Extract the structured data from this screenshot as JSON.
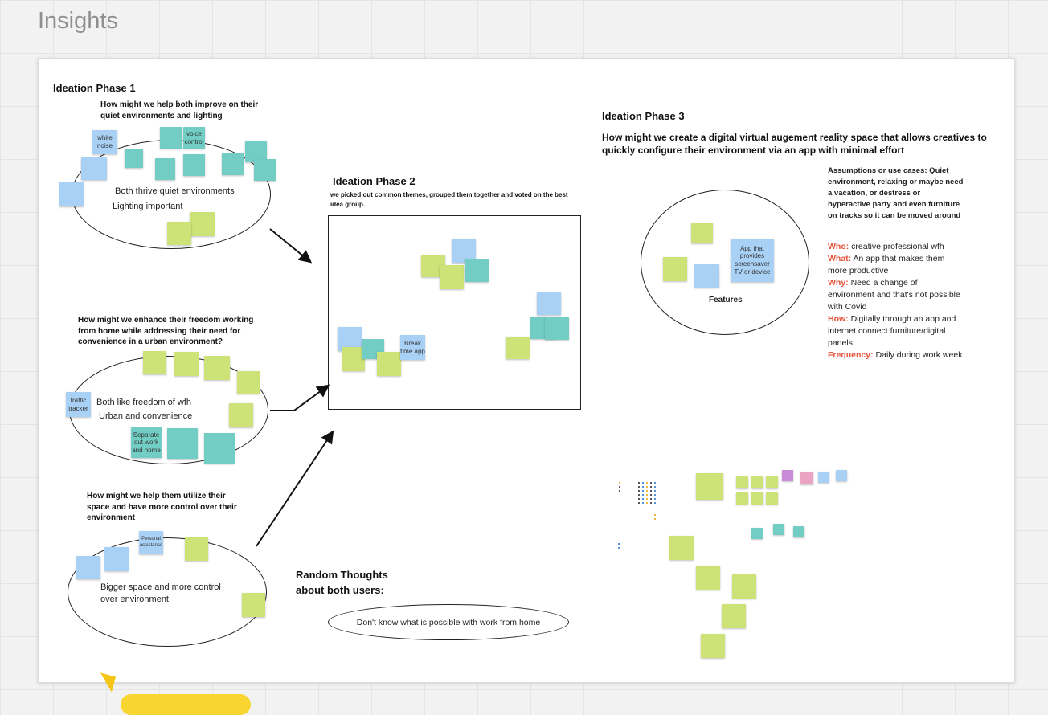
{
  "page": {
    "title": "Insights"
  },
  "phase1": {
    "heading": "Ideation Phase 1",
    "question": "How might we help both improve on their quiet environments and lighting",
    "label1": "Both thrive quiet  environments",
    "label2": "Lighting important",
    "notes": {
      "white_noise": "white noise",
      "voice_control": "voice control"
    }
  },
  "cluster2": {
    "question": "How might we enhance their freedom working from home while addressing their need for convenience in a urban environment?",
    "label1": "Both like freedom of wfh",
    "label2": "Urban and convenience",
    "notes": {
      "traffic_tracker": "traffic tracker",
      "separate": "Separate out work and home"
    }
  },
  "cluster3": {
    "question": "How might we help them utilize their space and have more control over their environment",
    "label1": "Bigger space and more control",
    "label2": "over environment",
    "notes": {
      "personal": "Personal assistance"
    }
  },
  "phase2": {
    "heading": "Ideation Phase 2",
    "desc": "we picked out common themes, grouped them together and voted on the best idea group.",
    "notes": {
      "break_time": "Break time app"
    }
  },
  "phase3": {
    "heading": "Ideation Phase 3",
    "question": "How might we create a digital virtual augement reality space that allows creatives to quickly configure their environment via an app with minimal effort",
    "features": "Features",
    "notes": {
      "app": "App that provides screensaver TV or device"
    },
    "assumptions": "Assumptions or use cases:  Quiet environment, relaxing or maybe need a vacation, or destress or hyperactive party and even furniture on tracks so it can be moved around",
    "who_key": "Who:",
    "who_val": " creative professional wfh",
    "what_key": "What:",
    "what_val": "  An app that makes them more productive",
    "why_key": "Why:",
    "why_val": "  Need a change of environment and that's not possible with Covid",
    "how_key": "How:",
    "how_val": "  Digitally through an app and internet connect furniture/digital panels",
    "freq_key": "Frequency:",
    "freq_val": " Daily during work week"
  },
  "random": {
    "heading": "Random Thoughts about both users:",
    "thought": "Don't know what is possible with work from home"
  },
  "colors": {
    "yellow": "#cde378",
    "blue": "#a9d0f5",
    "teal": "#72cdc4",
    "red": "#e5533d"
  }
}
